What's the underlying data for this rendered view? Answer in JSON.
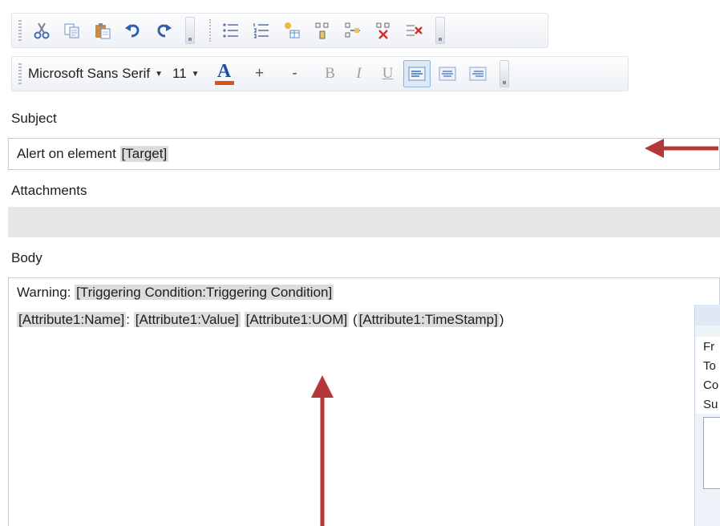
{
  "toolbar_edit": {
    "buttons": [
      {
        "name": "cut-icon"
      },
      {
        "name": "copy-icon"
      },
      {
        "name": "paste-icon"
      },
      {
        "name": "undo-icon"
      },
      {
        "name": "redo-icon"
      }
    ],
    "list_buttons": [
      {
        "name": "bullet-list-icon"
      },
      {
        "name": "numbered-list-icon"
      },
      {
        "name": "insert-table-icon"
      },
      {
        "name": "insert-row-icon"
      },
      {
        "name": "insert-column-icon"
      },
      {
        "name": "delete-row-icon"
      },
      {
        "name": "delete-column-icon"
      }
    ]
  },
  "toolbar_format": {
    "font_family": "Microsoft Sans Serif",
    "font_size": "11",
    "font_color_glyph": "A",
    "font_color_hex": "#e0521a",
    "grow_label": "+",
    "shrink_label": "-",
    "bold_label": "B",
    "italic_label": "I",
    "underline_label": "U",
    "alignment": "left"
  },
  "subject": {
    "label": "Subject",
    "prefix": "Alert on element ",
    "token": "[Target]"
  },
  "attachments": {
    "label": "Attachments"
  },
  "body": {
    "label": "Body",
    "line1": {
      "prefix": "Warning: ",
      "token": "[Triggering Condition:Triggering Condition]"
    },
    "line2": {
      "t1": "[Attribute1:Name]",
      "s1": ": ",
      "t2": "[Attribute1:Value]",
      "s2": " ",
      "t3": "[Attribute1:UOM]",
      "s3": " (",
      "t4": "[Attribute1:TimeStamp]",
      "s4": ")"
    }
  },
  "preview": {
    "rows": [
      "Fr",
      "To",
      "Co",
      "Su"
    ]
  },
  "annotation_color": "#b5373a"
}
